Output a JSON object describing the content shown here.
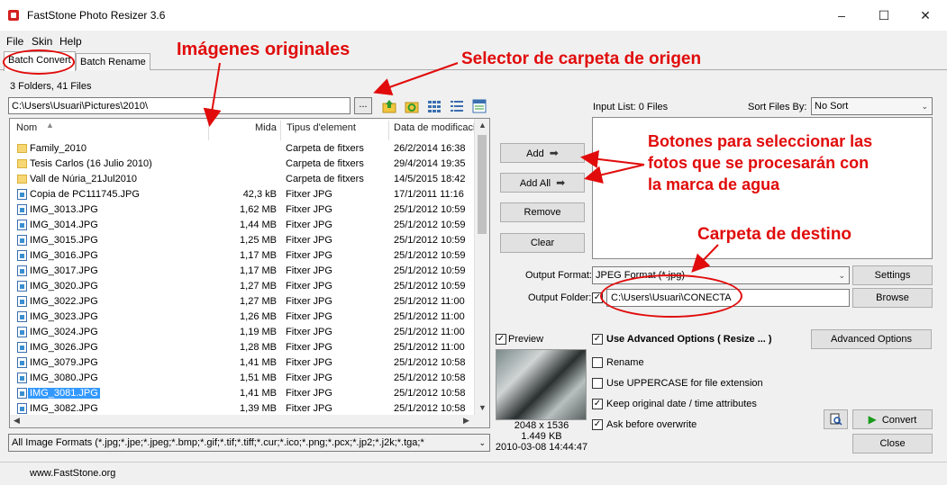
{
  "window": {
    "title": "FastStone Photo Resizer 3.6"
  },
  "menu": [
    "File",
    "Skin",
    "Help"
  ],
  "tabs": [
    "Batch Convert",
    "Batch Rename"
  ],
  "source": {
    "folder_count": "3 Folders, 41 Files",
    "path": "C:\\Users\\Usuari\\Pictures\\2010\\",
    "browse_label": "..."
  },
  "file_list": {
    "columns": [
      "Nom",
      "Mida",
      "Tipus d'element",
      "Data de modificació"
    ],
    "rows": [
      {
        "kind": "folder",
        "name": "Family_2010",
        "size": "",
        "type": "Carpeta de fitxers",
        "date": "26/2/2014 16:38"
      },
      {
        "kind": "folder",
        "name": "Tesis Carlos (16 Julio 2010)",
        "size": "",
        "type": "Carpeta de fitxers",
        "date": "29/4/2014 19:35"
      },
      {
        "kind": "folder",
        "name": "Vall de Núria_21Jul2010",
        "size": "",
        "type": "Carpeta de fitxers",
        "date": "14/5/2015 18:42"
      },
      {
        "kind": "jpg",
        "name": "Copia de PC111745.JPG",
        "size": "42,3 kB",
        "type": "Fitxer JPG",
        "date": "17/1/2011 11:16"
      },
      {
        "kind": "jpg",
        "name": "IMG_3013.JPG",
        "size": "1,62 MB",
        "type": "Fitxer JPG",
        "date": "25/1/2012 10:59"
      },
      {
        "kind": "jpg",
        "name": "IMG_3014.JPG",
        "size": "1,44 MB",
        "type": "Fitxer JPG",
        "date": "25/1/2012 10:59"
      },
      {
        "kind": "jpg",
        "name": "IMG_3015.JPG",
        "size": "1,25 MB",
        "type": "Fitxer JPG",
        "date": "25/1/2012 10:59"
      },
      {
        "kind": "jpg",
        "name": "IMG_3016.JPG",
        "size": "1,17 MB",
        "type": "Fitxer JPG",
        "date": "25/1/2012 10:59"
      },
      {
        "kind": "jpg",
        "name": "IMG_3017.JPG",
        "size": "1,17 MB",
        "type": "Fitxer JPG",
        "date": "25/1/2012 10:59"
      },
      {
        "kind": "jpg",
        "name": "IMG_3020.JPG",
        "size": "1,27 MB",
        "type": "Fitxer JPG",
        "date": "25/1/2012 10:59"
      },
      {
        "kind": "jpg",
        "name": "IMG_3022.JPG",
        "size": "1,27 MB",
        "type": "Fitxer JPG",
        "date": "25/1/2012 11:00"
      },
      {
        "kind": "jpg",
        "name": "IMG_3023.JPG",
        "size": "1,26 MB",
        "type": "Fitxer JPG",
        "date": "25/1/2012 11:00"
      },
      {
        "kind": "jpg",
        "name": "IMG_3024.JPG",
        "size": "1,19 MB",
        "type": "Fitxer JPG",
        "date": "25/1/2012 11:00"
      },
      {
        "kind": "jpg",
        "name": "IMG_3026.JPG",
        "size": "1,28 MB",
        "type": "Fitxer JPG",
        "date": "25/1/2012 11:00"
      },
      {
        "kind": "jpg",
        "name": "IMG_3079.JPG",
        "size": "1,41 MB",
        "type": "Fitxer JPG",
        "date": "25/1/2012 10:58"
      },
      {
        "kind": "jpg",
        "name": "IMG_3080.JPG",
        "size": "1,51 MB",
        "type": "Fitxer JPG",
        "date": "25/1/2012 10:58"
      },
      {
        "kind": "jpg",
        "name": "IMG_3081.JPG",
        "size": "1,41 MB",
        "type": "Fitxer JPG",
        "date": "25/1/2012 10:58",
        "selected": true
      },
      {
        "kind": "jpg",
        "name": "IMG_3082.JPG",
        "size": "1,39 MB",
        "type": "Fitxer JPG",
        "date": "25/1/2012 10:58"
      }
    ],
    "format_filter": "All Image Formats (*.jpg;*.jpe;*.jpeg;*.bmp;*.gif;*.tif;*.tiff;*.cur;*.ico;*.png;*.pcx;*.jp2;*.j2k;*.tga;*"
  },
  "actions": {
    "add": "Add",
    "add_all": "Add All",
    "remove": "Remove",
    "clear": "Clear"
  },
  "input_list": {
    "label": "Input List:  0 Files",
    "sort_label": "Sort Files By:",
    "sort_value": "No Sort"
  },
  "output": {
    "format_label": "Output Format:",
    "format_value": "JPEG Format (*.jpg)",
    "settings": "Settings",
    "folder_label": "Output Folder:",
    "folder_value": "C:\\Users\\Usuari\\CONECTA",
    "browse": "Browse"
  },
  "preview": {
    "label": "Preview",
    "dimensions": "2048 x 1536",
    "size": "1.449 KB",
    "date": "2010-03-08 14:44:47"
  },
  "options": {
    "advanced_checkbox": "Use Advanced Options ( Resize ... )",
    "advanced_button": "Advanced Options",
    "rename": "Rename",
    "uppercase": "Use UPPERCASE for file extension",
    "keep_date": "Keep original date / time attributes",
    "ask_overwrite": "Ask before overwrite"
  },
  "buttons": {
    "convert": "Convert",
    "close": "Close"
  },
  "status": {
    "website": "www.FastStone.org"
  },
  "annotations": {
    "images": "Imágenes originales",
    "selector": "Selector de carpeta de origen",
    "buttons_line1": "Botones para seleccionar las",
    "buttons_line2": "fotos que se procesarán con",
    "buttons_line3": "la marca de agua",
    "destination": "Carpeta de destino",
    "color": "#e10b0b"
  }
}
